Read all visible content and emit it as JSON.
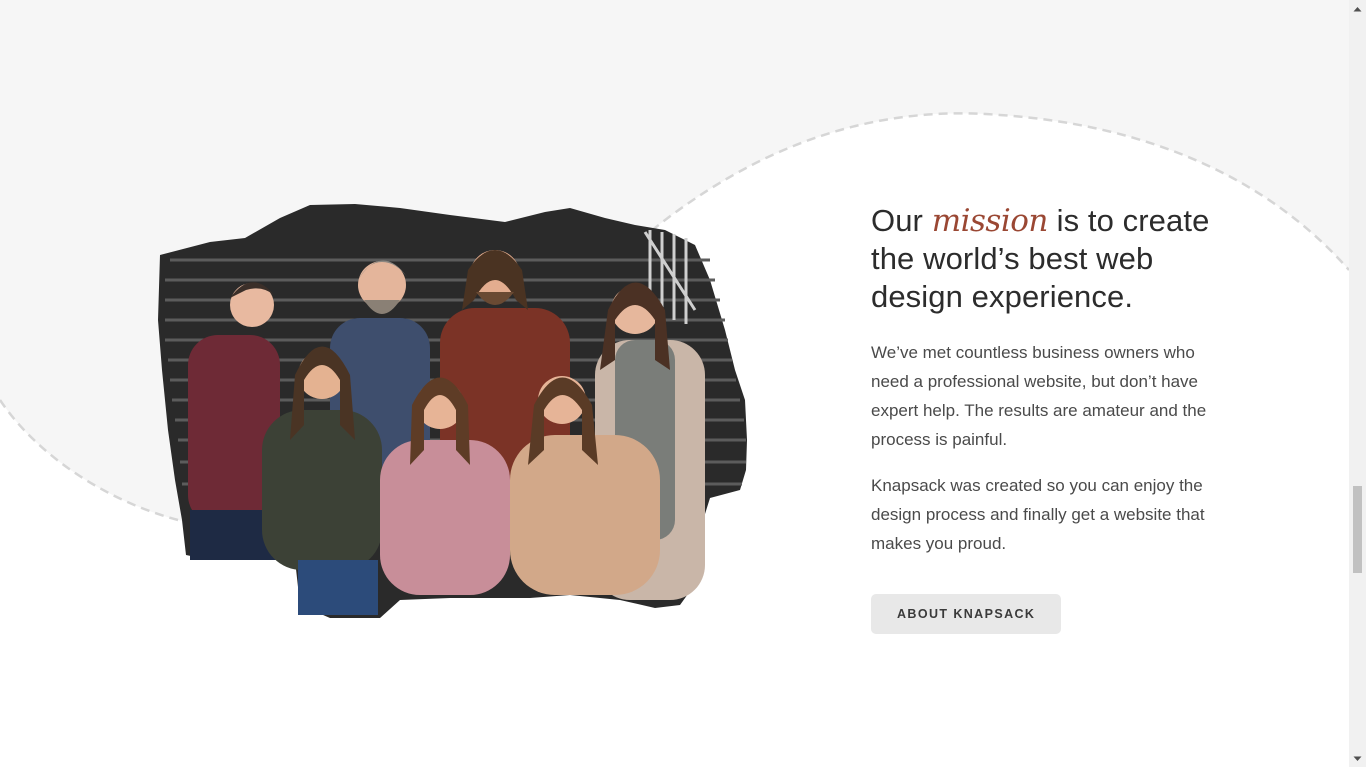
{
  "mission": {
    "headline_before": "Our ",
    "headline_accent": "mission",
    "headline_after": " is to create the world’s best web design experience.",
    "paragraph_1": "We’ve met countless business owners who need a professional website, but don’t have expert help. The results are amateur and the process is painful.",
    "paragraph_2": "Knapsack was created so you can enjoy the design process and finally get a website that makes you proud.",
    "button_label": "ABOUT KNAPSACK"
  },
  "photo": {
    "icon": "team-group-photo"
  },
  "colors": {
    "background": "#f6f6f6",
    "accent": "#9a4733",
    "heading": "#2c2c2c",
    "body_text": "#4a4a4a",
    "button_bg": "#e8e8e8"
  }
}
